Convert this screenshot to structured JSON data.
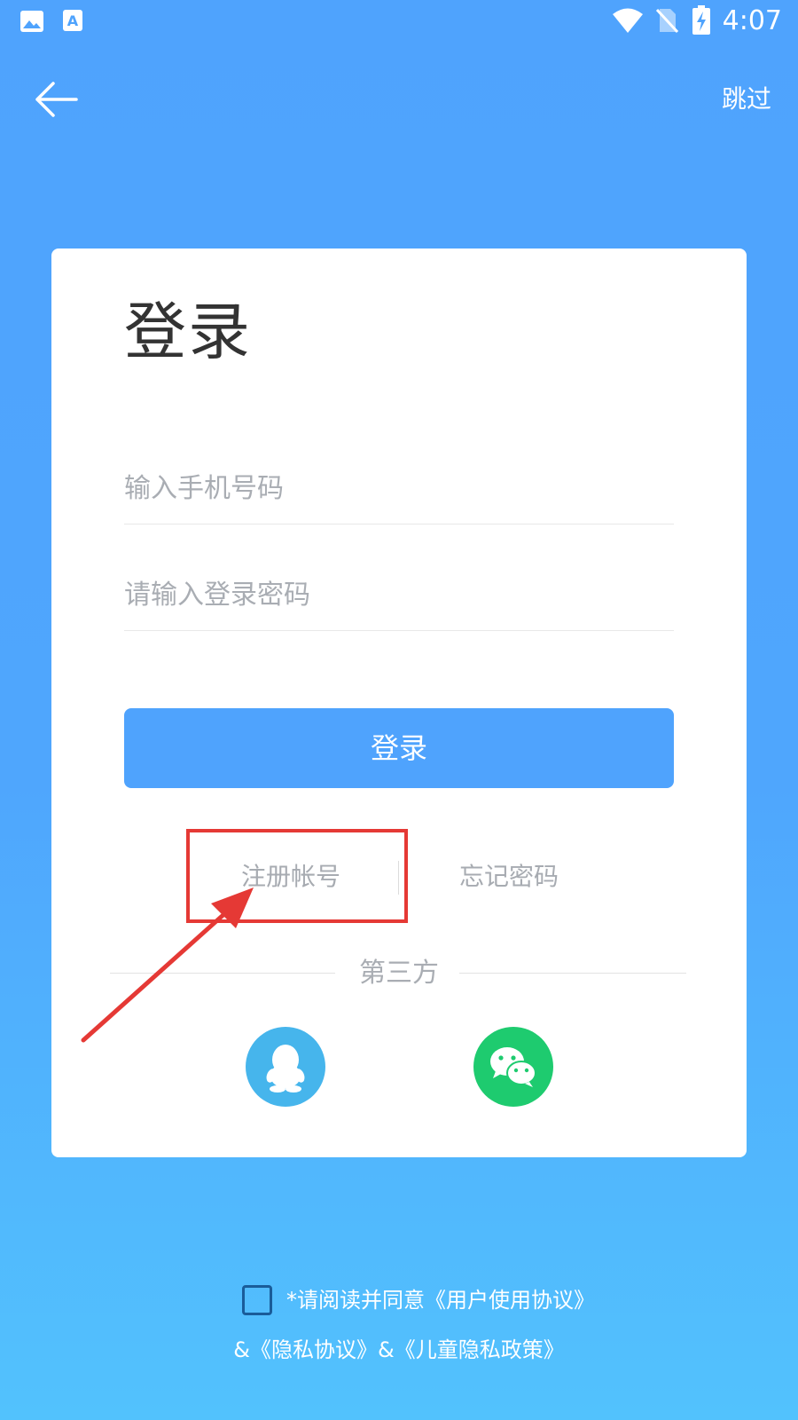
{
  "status_bar": {
    "time": "4:07",
    "icons": [
      "image-notification-icon",
      "a-notification-icon",
      "wifi-icon",
      "no-sim-icon",
      "battery-charging-icon"
    ]
  },
  "header": {
    "back_icon": "arrow-left-icon",
    "skip_label": "跳过"
  },
  "login_card": {
    "title": "登录",
    "phone_placeholder": "输入手机号码",
    "password_placeholder": "请输入登录密码",
    "login_button": "登录",
    "register_link": "注册帐号",
    "forgot_link": "忘记密码",
    "third_party_label": "第三方",
    "social": [
      {
        "name": "qq-icon",
        "color": "#46b5ec"
      },
      {
        "name": "wechat-icon",
        "color": "#1ecb6f"
      }
    ]
  },
  "agreement": {
    "line1": "*请阅读并同意《用户使用协议》",
    "line2": "&《隐私协议》&《儿童隐私政策》",
    "checked": false
  },
  "colors": {
    "primary": "#4fa3fd",
    "annotation": "#e53935",
    "qq": "#46b5ec",
    "wechat": "#1ecb6f"
  }
}
